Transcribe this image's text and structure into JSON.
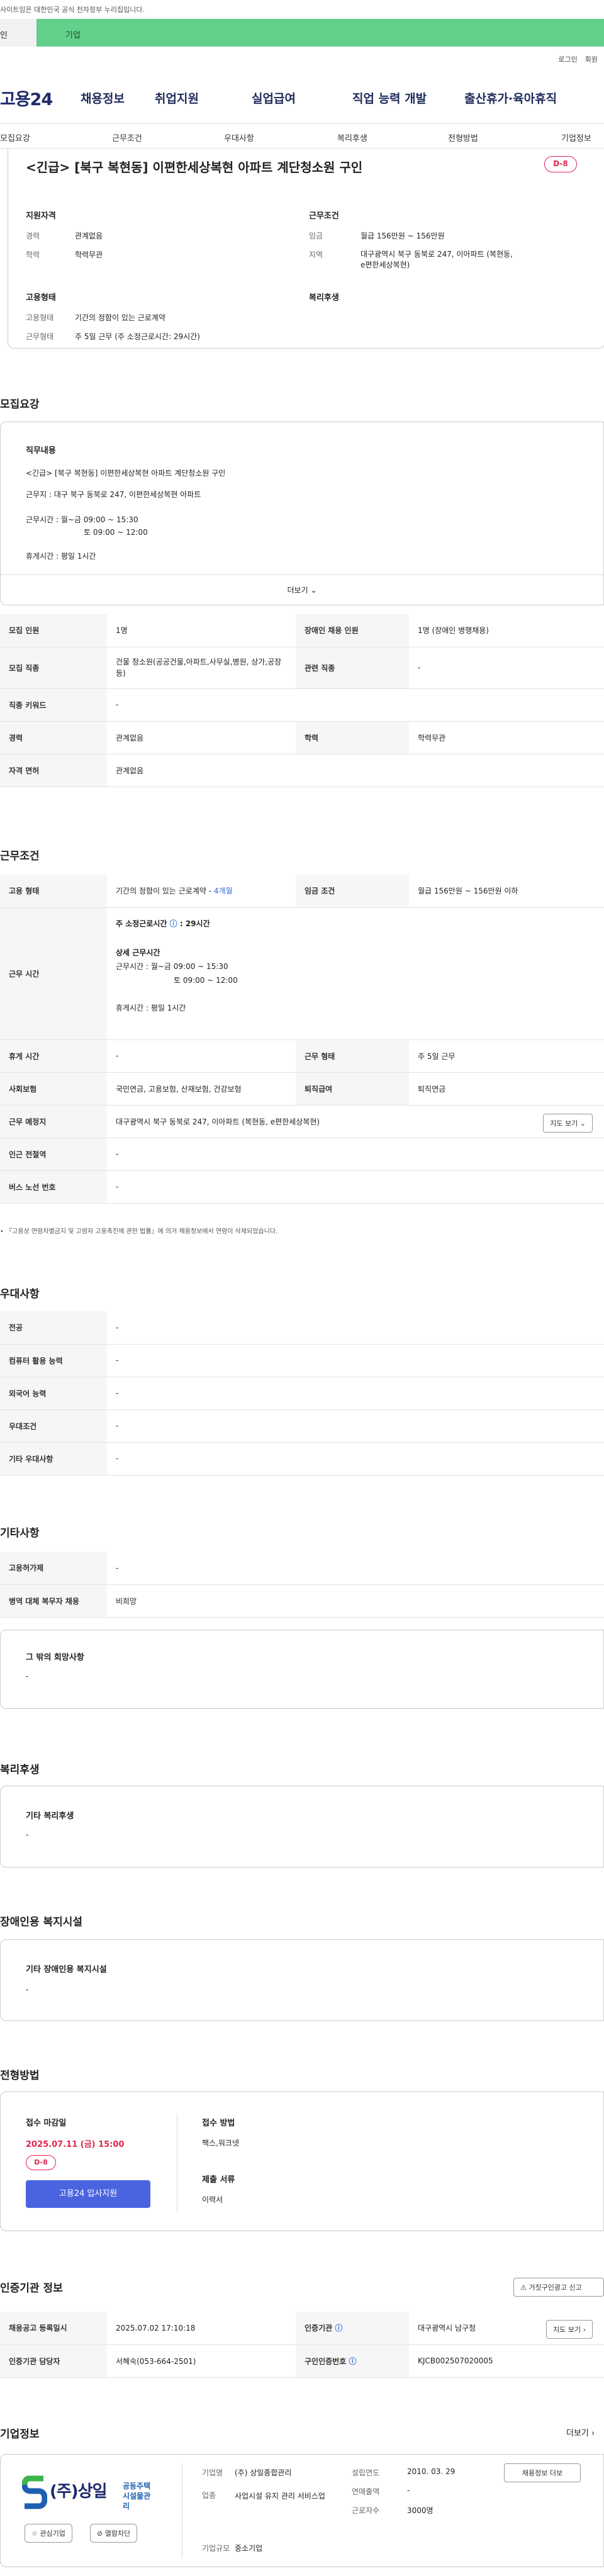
{
  "gov_notice": "사이트임은 대한민국 공식 전자정부 누리집입니다.",
  "top_tabs": {
    "individual": "인",
    "company": "기업"
  },
  "util": {
    "login": "로그인",
    "join": "회원"
  },
  "logo": "고용24",
  "gnb": [
    "채용정보",
    "취업지원",
    "실업급여",
    "직업 능력 개발",
    "출산휴가·육아휴직"
  ],
  "subnav": [
    "모집요강",
    "근무조건",
    "우대사항",
    "복리후생",
    "전형방법",
    "기업정보"
  ],
  "job": {
    "title": "<긴급> [북구 복현동] 이편한세상복현 아파트 계단청소원 구인",
    "dday": "D-8",
    "qual_title": "지원자격",
    "career_label": "경력",
    "career": "관계없음",
    "edu_label": "학력",
    "edu": "학력무관",
    "work_title": "근무조건",
    "wage_label": "임금",
    "wage": "월급 156만원 ~ 156만원",
    "region_label": "지역",
    "region": "대구광역시 북구 동북로 247, 이아파트 (복현동, e편한세상복현)",
    "emp_title": "고용형태",
    "emptype_label": "고용형태",
    "emptype": "기간의 정함이 있는 근로계약",
    "worktype_label": "근무형태",
    "worktype": "주 5일 근무 (주 소정근로시간: 29시간)",
    "welfare_title": "복리후생"
  },
  "recruit": {
    "section_title": "모집요강",
    "duty_title": "직무내용",
    "duty_lines": [
      "<긴급> [북구 복현동] 이편한세상복현 아파트 계단청소원 구인",
      "근무지 : 대구 북구 동북로 247, 이편한세상복현 아파트",
      "근무시간 : 월~금 09:00 ~ 15:30",
      "토 09:00 ~ 12:00",
      "휴게시간 : 평일 1시간"
    ],
    "more": "더보기",
    "rows": [
      {
        "th1": "모집 인원",
        "td1": "1명",
        "th2": "장애인 채용 인원",
        "td2": "1명 (장애인 병행채용)"
      },
      {
        "th1": "모집 직종",
        "td1": "건물 청소원(공공건물,아파트,사무실,병원, 상가,공장 등)",
        "th2": "관련 직종",
        "td2": "-"
      },
      {
        "th1": "직종 키워드",
        "td1": "-"
      },
      {
        "th1": "경력",
        "td1": "관계없음",
        "th2": "학력",
        "td2": "학력무관"
      },
      {
        "th1": "자격 면허",
        "td1": "관계없음"
      }
    ]
  },
  "conditions": {
    "section_title": "근무조건",
    "emp_label": "고용 형태",
    "emp_value": "기간의 정함이 있는 근로계약",
    "emp_months": "4개월",
    "wage_label": "임금 조건",
    "wage_value": "월급 156만원 ~ 156만원 이하",
    "time_label": "근무 시간",
    "time_main": "주 소정근로시간",
    "time_hours": "29시간",
    "time_detail_title": "상세 근무시간",
    "time_detail_1": "근무시간 : 월~금 09:00 ~ 15:30",
    "time_detail_2": "토 09:00 ~ 12:00",
    "time_detail_3": "휴게시간 : 평일 1시간",
    "break_label": "휴게 시간",
    "break_value": "-",
    "type_label": "근무 형태",
    "type_value": "주 5일 근무",
    "ins_label": "사회보험",
    "ins_value": "국민연금, 고용보험, 산재보험, 건강보험",
    "sev_label": "퇴직급여",
    "sev_value": "퇴직연금",
    "place_label": "근무 예정지",
    "place_value": "대구광역시 북구 동북로 247, 이아파트 (복현동, e편한세상복현)",
    "map_btn": "지도 보기",
    "subway_label": "인근 전철역",
    "subway_value": "-",
    "bus_label": "버스 노선 번호",
    "bus_value": "-",
    "footnote": "『고용상 연령차별금지 및 고령자 고용촉진에 관한 법률』에 의거 채용정보에서 연령이 삭제되었습니다."
  },
  "prefer": {
    "section_title": "우대사항",
    "rows": [
      {
        "th": "전공",
        "td": "-"
      },
      {
        "th": "컴퓨터 활용 능력",
        "td": "-"
      },
      {
        "th": "외국어 능력",
        "td": "-"
      },
      {
        "th": "우대조건",
        "td": "-"
      },
      {
        "th": "기타 우대사항",
        "td": "-"
      }
    ]
  },
  "etc": {
    "section_title": "기타사항",
    "rows": [
      {
        "th": "고용허가제",
        "td": "-"
      },
      {
        "th": "병역 대체 복무자 채용",
        "td": "비희망"
      }
    ],
    "other_title": "그 밖의 희망사항",
    "other_value": "-"
  },
  "welfare": {
    "section_title": "복리후생",
    "box_title": "기타 복리후생",
    "box_value": "-"
  },
  "disability": {
    "section_title": "장애인용 복지시설",
    "box_title": "기타 장애인용 복지시설",
    "box_value": "-"
  },
  "screening": {
    "section_title": "전형방법",
    "deadline_label": "접수 마감일",
    "deadline": "2025.07.11 (금) 15:00",
    "dday": "D-8",
    "apply_btn": "고용24 입사지원",
    "method_label": "접수 방법",
    "method": "팩스,워크넷",
    "docs_label": "제출 서류",
    "docs": "이력서"
  },
  "cert": {
    "section_title": "인증기관 정보",
    "report_btn": "거짓구인광고 신고",
    "reg_label": "채용공고 등록일시",
    "reg_value": "2025.07.02 17:10:18",
    "org_label": "인증기관",
    "org_value": "대구광역시 남구청",
    "manager_label": "인증기관 담당자",
    "manager_value": "서혜숙(053-664-2501)",
    "no_label": "구인인증번호",
    "no_value": "KJCB002507020005",
    "map_btn": "지도 보기"
  },
  "company": {
    "section_title": "기업정보",
    "more": "더보기",
    "logo_text": "(주)상일",
    "logo_sub1": "공동주택",
    "logo_sub2": "시설물관리",
    "fav_btn": "관심기업",
    "block_btn": "열람차단",
    "name_label": "기업명",
    "name": "(주) 상일종합관리",
    "industry_label": "업종",
    "industry": "사업시설 유지 관리 서비스업",
    "size_label": "기업규모",
    "size": "중소기업",
    "est_label": "설립연도",
    "est": "2010. 03. 29",
    "sales_label": "연매출액",
    "sales": "-",
    "emp_label": "근로자수",
    "emp": "3000명",
    "jobs_btn": "채용정보 더보"
  },
  "colors": {
    "accent": "#2f6fdd",
    "dday": "#e0244e",
    "apply_btn": "#4a64e0",
    "tab_green": "#62d08a",
    "navy": "#1d2a6c"
  }
}
